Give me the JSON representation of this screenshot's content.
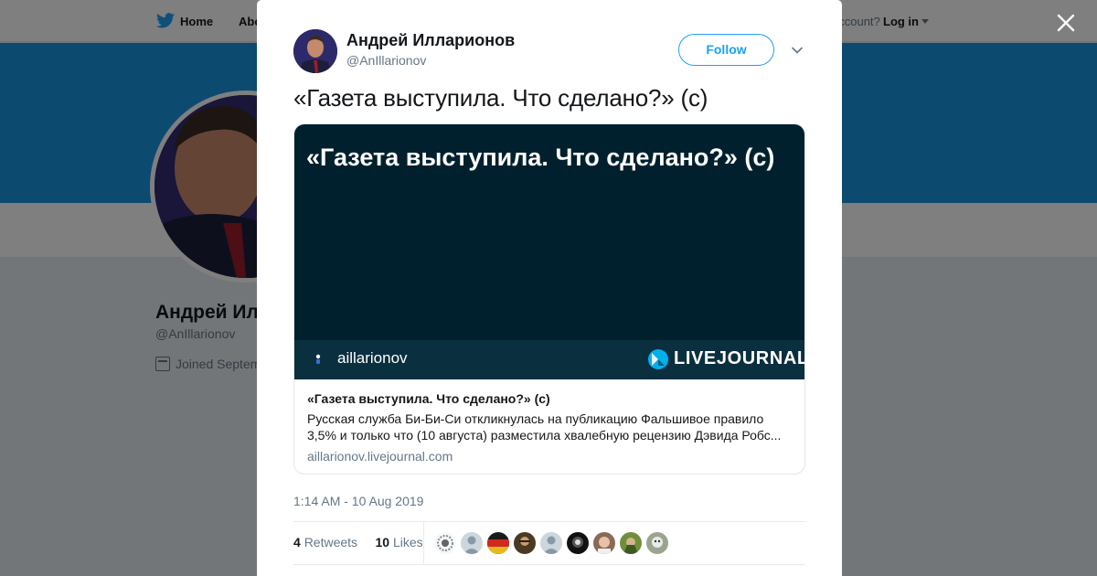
{
  "background_page": {
    "nav": {
      "home_label": "Home",
      "about_label": "Abo",
      "account_prompt": "account?",
      "login_label": "Log in"
    },
    "profile": {
      "name": "Андрей Ил",
      "handle": "@AnIllarionov",
      "joined": "Joined Septem"
    }
  },
  "tweet": {
    "author_name": "Андрей Илларионов",
    "author_handle": "@AnIllarionov",
    "follow_label": "Follow",
    "text": "«Газета выступила. Что сделано?» (с)",
    "card": {
      "image_title": "«Газета выступила. Что сделано?» (с)",
      "image_user": "aillarionov",
      "image_brand": "LIVEJOURNAL",
      "title": "«Газета выступила. Что сделано?» (с)",
      "description": "Русская служба Би-Би-Си откликнулась на публикацию Фальшивое правило 3,5% и только что (10 августа) разместила хвалебную рецензию Дэвида Робс...",
      "domain": "aillarionov.livejournal.com"
    },
    "timestamp": "1:14 AM - 10 Aug 2019",
    "stats": {
      "retweets_count": "4",
      "retweets_label": "Retweets",
      "likes_count": "10",
      "likes_label": "Likes"
    }
  },
  "colors": {
    "brand_blue": "#1da1f2",
    "banner_blue": "#1b95e0",
    "card_image_bg": "#01202d",
    "muted_text": "#657786"
  },
  "icons": {
    "twitter_logo": "twitter-bird-icon",
    "close": "close-icon",
    "caret": "chevron-down-icon",
    "calendar": "calendar-icon",
    "livejournal": "livejournal-logo-icon"
  }
}
